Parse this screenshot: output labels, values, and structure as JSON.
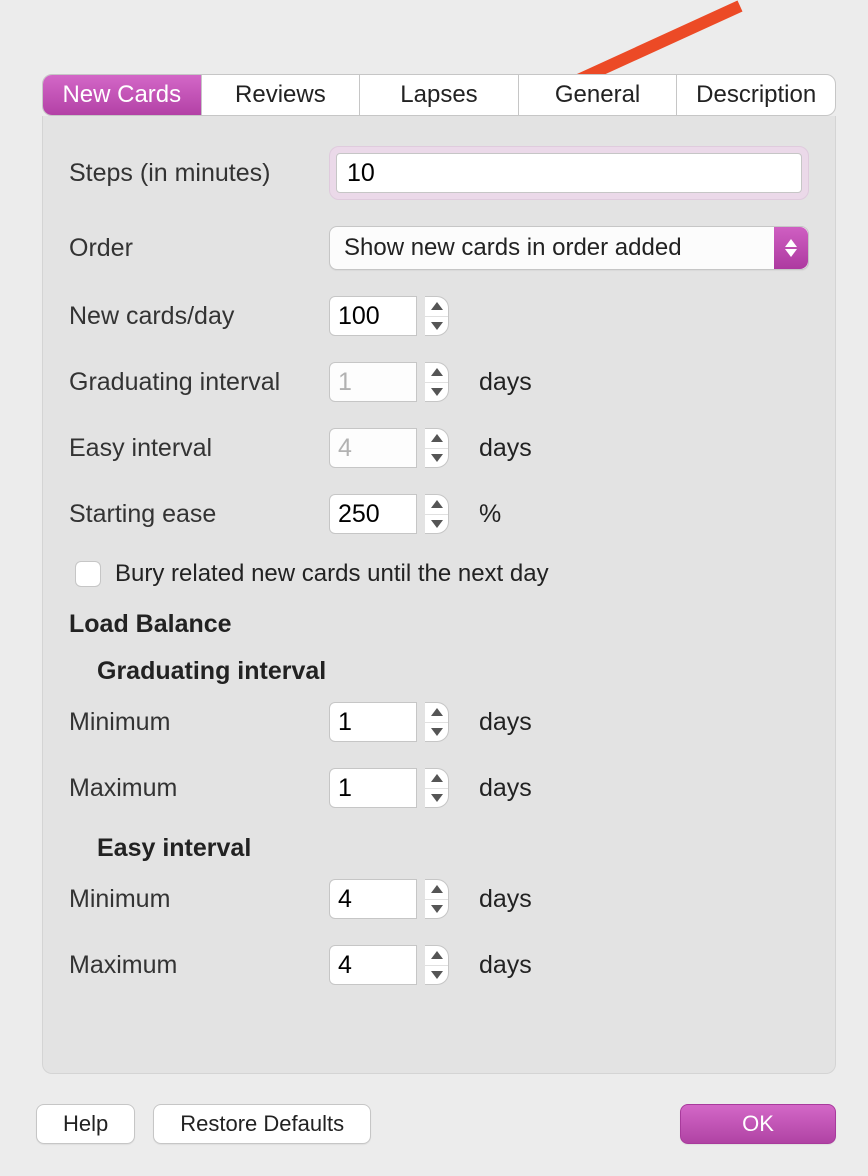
{
  "tabs": {
    "new_cards": "New Cards",
    "reviews": "Reviews",
    "lapses": "Lapses",
    "general": "General",
    "description": "Description"
  },
  "fields": {
    "steps": {
      "label": "Steps (in minutes)",
      "value": "10"
    },
    "order": {
      "label": "Order",
      "value": "Show new cards in order added"
    },
    "per_day": {
      "label": "New cards/day",
      "value": "100"
    },
    "grad_interval": {
      "label": "Graduating interval",
      "value": "1",
      "unit": "days"
    },
    "easy_interval": {
      "label": "Easy interval",
      "value": "4",
      "unit": "days"
    },
    "starting_ease": {
      "label": "Starting ease",
      "value": "250",
      "unit": "%"
    },
    "bury": {
      "label": "Bury related new cards until the next day",
      "checked": false
    }
  },
  "load_balance": {
    "heading": "Load Balance",
    "grad_heading": "Graduating interval",
    "grad_min": {
      "label": "Minimum",
      "value": "1",
      "unit": "days"
    },
    "grad_max": {
      "label": "Maximum",
      "value": "1",
      "unit": "days"
    },
    "easy_heading": "Easy interval",
    "easy_min": {
      "label": "Minimum",
      "value": "4",
      "unit": "days"
    },
    "easy_max": {
      "label": "Maximum",
      "value": "4",
      "unit": "days"
    }
  },
  "buttons": {
    "help": "Help",
    "restore": "Restore Defaults",
    "ok": "OK"
  }
}
